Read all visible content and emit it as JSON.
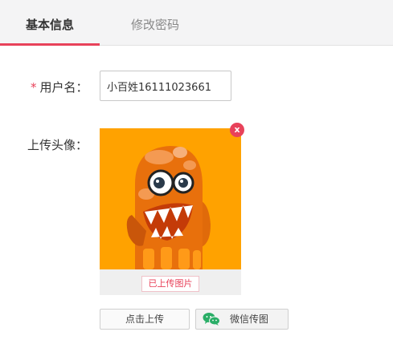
{
  "tabs": [
    {
      "label": "基本信息",
      "active": true
    },
    {
      "label": "修改密码",
      "active": false
    }
  ],
  "form": {
    "username": {
      "required_mark": "*",
      "label": "用户名：",
      "value": "小百姓16111023661"
    },
    "avatar": {
      "label": "上传头像：",
      "uploaded_tag": "已上传图片",
      "close_symbol": "x",
      "upload_button": "点击上传",
      "wechat_button": "微信传图"
    }
  },
  "colors": {
    "accent": "#e8425a",
    "avatar_bg": "#ffa200",
    "wechat": "#2aae67"
  }
}
